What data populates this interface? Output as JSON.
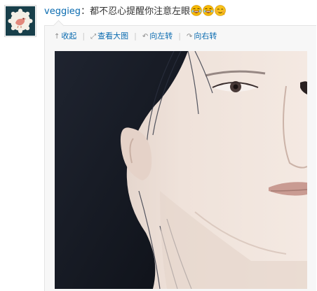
{
  "post": {
    "username": "veggieg",
    "colon": "：",
    "text": "都不忍心提醒你注意左眼",
    "emojis": [
      "laughing-tears-emoji",
      "laughing-tears-emoji",
      "smiling-emoji"
    ]
  },
  "toolbar": {
    "collapse_label": "收起",
    "view_large_label": "查看大图",
    "rotate_left_label": "向左转",
    "rotate_right_label": "向右转",
    "icons": [
      "up-arrow-icon",
      "expand-icon",
      "rotate-left-icon",
      "rotate-right-icon"
    ],
    "separator": "|"
  },
  "colors": {
    "link": "#0a6bb0",
    "avatar_bg": "#183f4a"
  }
}
